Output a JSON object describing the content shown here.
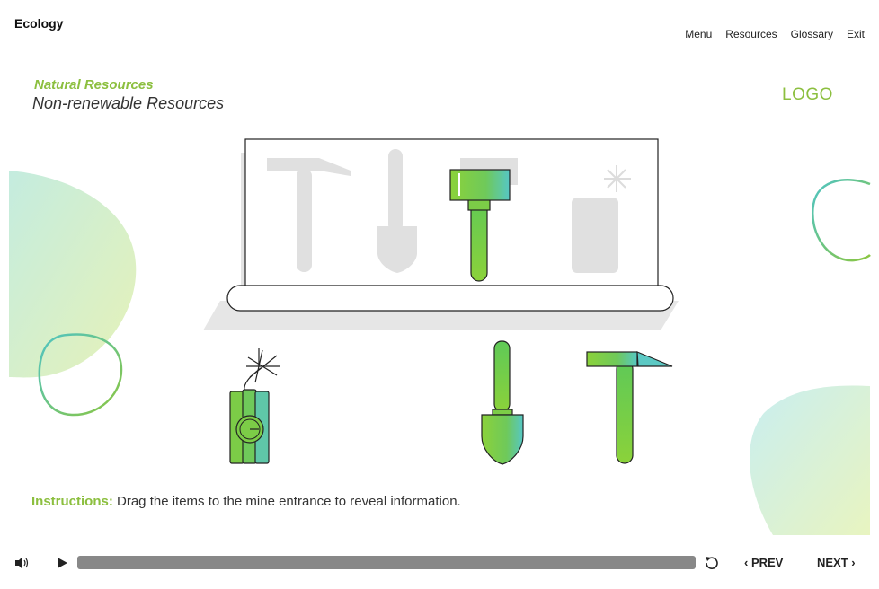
{
  "header": {
    "course_title": "Ecology",
    "nav": [
      "Menu",
      "Resources",
      "Glossary",
      "Exit"
    ]
  },
  "content": {
    "section_label": "Natural Resources",
    "page_heading": "Non-renewable Resources",
    "logo": "LOGO"
  },
  "activity": {
    "drop_zone_items": [
      "pickaxe-icon",
      "shovel-icon",
      "sledgehammer-icon",
      "dynamite-icon"
    ],
    "placed_item": "sledgehammer-icon",
    "draggable_items": [
      "dynamite-icon",
      "shovel-icon",
      "pickaxe-icon"
    ]
  },
  "instructions": {
    "label": "Instructions:",
    "text": " Drag the items to the mine entrance to reveal information."
  },
  "player": {
    "prev_label": "PREV",
    "next_label": "NEXT"
  },
  "colors": {
    "accent": "#8cbf3f",
    "teal": "#5cc9c4",
    "item_green": "#7ccc47",
    "placeholder_gray": "#e0e0e0"
  }
}
